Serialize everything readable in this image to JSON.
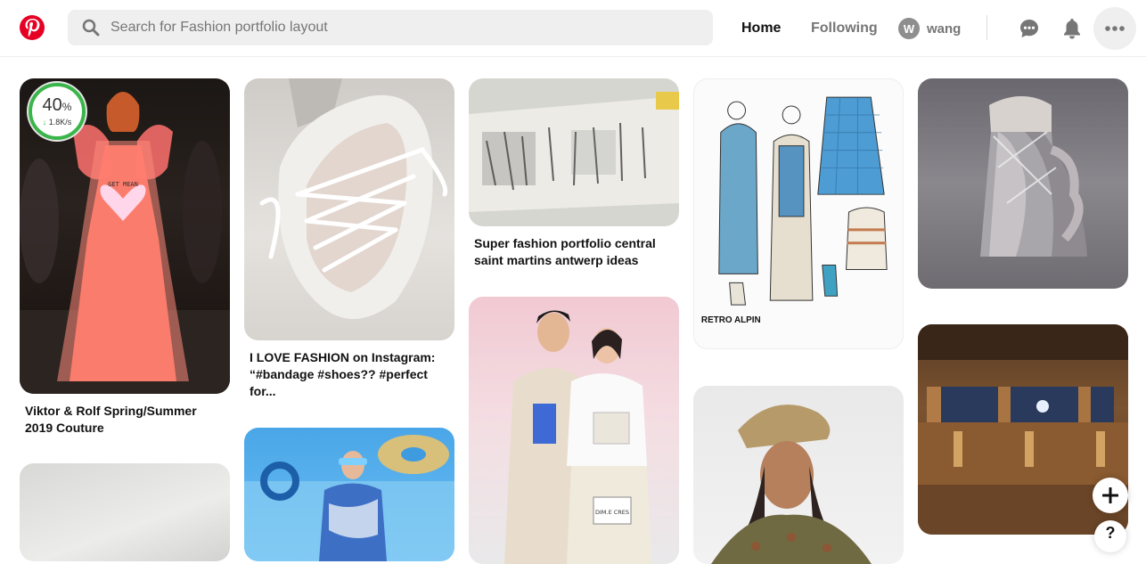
{
  "header": {
    "logo_icon": "pinterest-logo",
    "search_placeholder": "Search for Fashion portfolio layout",
    "nav_home": "Home",
    "nav_following": "Following",
    "user_initial": "W",
    "user_name": "wang",
    "messages_icon": "chat-icon",
    "notifications_icon": "bell-icon",
    "more_icon": "ellipsis-icon"
  },
  "download_badge": {
    "percent": "40",
    "percent_unit": "%",
    "rate": "1.8K/s"
  },
  "pins": [
    {
      "caption": "Viktor & Rolf Spring/Summer 2019 Couture"
    },
    {
      "caption": "I LOVE FASHION on Instagram: “#bandage #shoes?? #perfect for..."
    },
    {
      "caption": "Super fashion portfolio central saint martins antwerp ideas"
    },
    {
      "caption": ""
    },
    {
      "caption": ""
    }
  ],
  "image_text": {
    "pin1_heart": "GET MEAN",
    "pin4_retro": "RETRO ALPIN",
    "pin8_bag": "DIM.E CRES"
  },
  "fab": {
    "add_icon": "plus-icon",
    "help_label": "?"
  },
  "colors": {
    "brand": "#e60023",
    "accent_progress": "#3ab54a"
  }
}
